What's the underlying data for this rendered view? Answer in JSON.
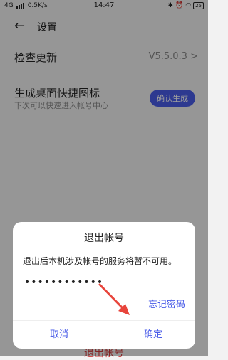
{
  "status_bar": {
    "network": "4G",
    "speed": "0.5K/s",
    "time": "14:47",
    "battery": "25"
  },
  "header": {
    "back_icon": "←",
    "title": "设置"
  },
  "settings": {
    "update_label": "检查更新",
    "version": "V5.5.0.3",
    "chevron": ">",
    "shortcut_label": "生成桌面快捷图标",
    "shortcut_sub": "下次可以快速进入帐号中心",
    "shortcut_button": "确认生成"
  },
  "bottom_peek": "退出帐号",
  "dialog": {
    "title": "退出帐号",
    "message": "退出后本机涉及帐号的服务将暂不可用。",
    "password_value": "••••••••••••",
    "forgot_password": "忘记密码",
    "cancel": "取消",
    "confirm": "确定"
  },
  "colors": {
    "accent": "#4a5ce8",
    "danger": "#d03a3a",
    "arrow": "#e8453c"
  }
}
